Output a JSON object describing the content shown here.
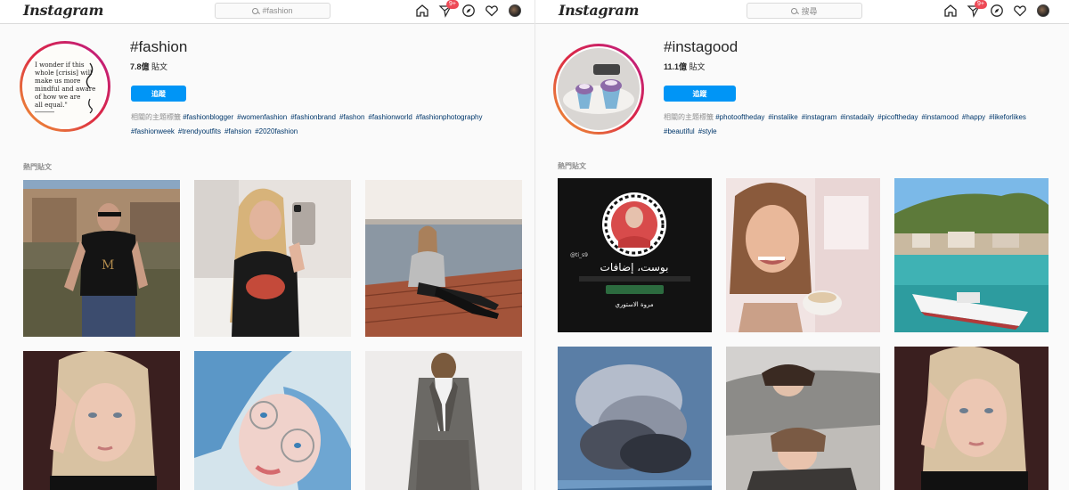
{
  "brand": {
    "logo_text": "Instagram"
  },
  "left": {
    "search_value": "#fashion",
    "notification_badge": "9+",
    "tag": "#fashion",
    "post_count": "7.8億",
    "post_unit": "貼文",
    "follow_label": "追蹤",
    "related_label": "相關的主題標籤",
    "related_tags": [
      "#fashionblogger",
      "#womenfashion",
      "#fashionbrand",
      "#fashon",
      "#fashionworld",
      "#fashionphotography",
      "#fashionweek",
      "#trendyoutfits",
      "#fahsion",
      "#2020fashion"
    ],
    "profile_quote": [
      "I wonder if this",
      "whole [crisis] will",
      "make us more",
      "mindful and aware",
      "of how we are",
      "all equal.\""
    ],
    "section_label": "熱門貼文",
    "tiles": [
      {
        "desc": "man-in-black-tshirt"
      },
      {
        "desc": "mirror-selfie"
      },
      {
        "desc": "woman-on-pier"
      },
      {
        "desc": "blonde-portrait"
      },
      {
        "desc": "blue-hair-glasses"
      },
      {
        "desc": "grey-suit-outfit"
      }
    ]
  },
  "right": {
    "search_placeholder": "搜尋",
    "notification_badge": "9+",
    "tag": "#instagood",
    "post_count": "11.1億",
    "post_unit": "貼文",
    "follow_label": "追蹤",
    "related_label": "相關的主題標籤",
    "related_tags": [
      "#photooftheday",
      "#instalike",
      "#instagram",
      "#instadaily",
      "#picoftheday",
      "#instamood",
      "#happy",
      "#likeforlikes",
      "#beautiful",
      "#style"
    ],
    "section_label": "熱門貼文",
    "arabic_line1": "بوست، إضافات",
    "arabic_line2": "مروة الاستوري",
    "watermark": "@ti_s9",
    "tiles": [
      {
        "desc": "arabic-quote-post"
      },
      {
        "desc": "smiling-woman-coffee"
      },
      {
        "desc": "harbor-boat"
      },
      {
        "desc": "volcano-eruption"
      },
      {
        "desc": "two-girls-selfie"
      },
      {
        "desc": "blonde-portrait"
      }
    ]
  },
  "colors": {
    "accent": "#0095f6",
    "badge": "#ed4956",
    "link": "#00376b"
  }
}
